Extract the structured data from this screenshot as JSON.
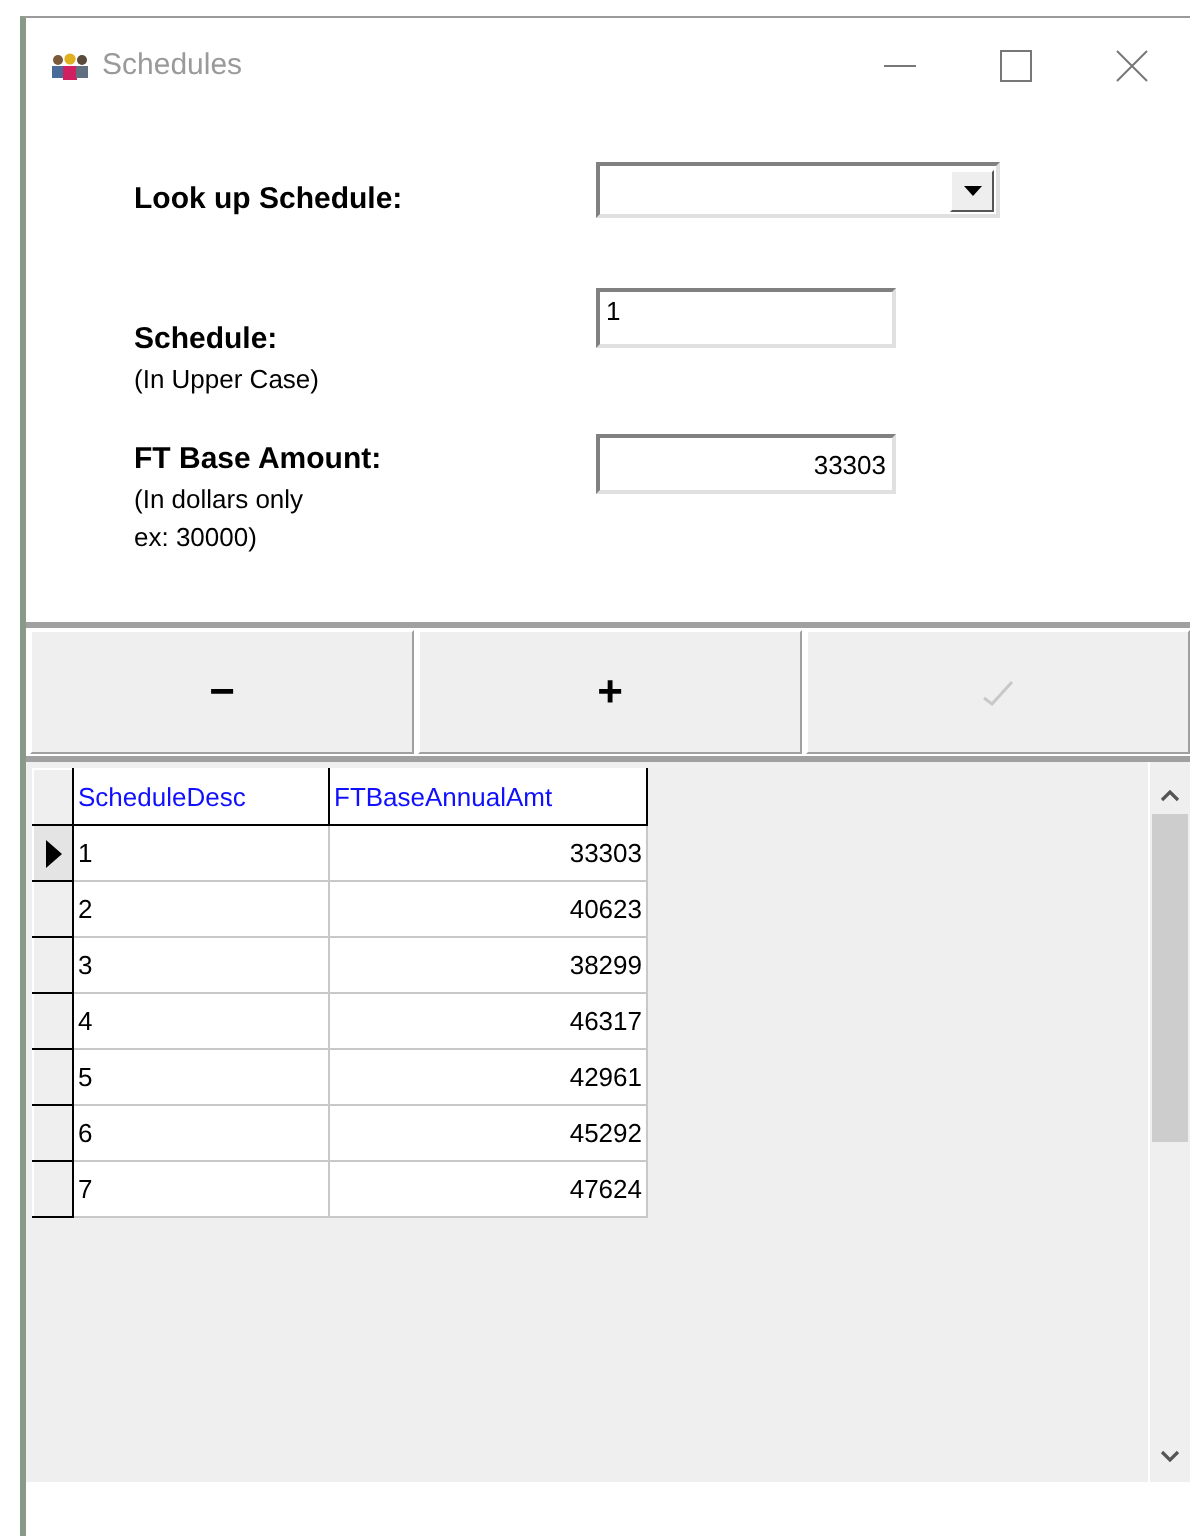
{
  "window": {
    "title": "Schedules"
  },
  "form": {
    "lookup": {
      "label": "Look up Schedule:"
    },
    "schedule": {
      "label": "Schedule:",
      "hint": "(In Upper Case)",
      "value": "1"
    },
    "amount": {
      "label": "FT Base Amount:",
      "hint_lines": [
        "(In dollars only",
        "ex: 30000)"
      ],
      "value": "33303"
    }
  },
  "buttons": [
    {
      "kind": "remove",
      "label": "−",
      "disabled": false
    },
    {
      "kind": "add",
      "label": "+",
      "disabled": false
    },
    {
      "kind": "confirm",
      "disabled": true
    }
  ],
  "table": {
    "columns": [
      "ScheduleDesc",
      "FTBaseAnnualAmt"
    ],
    "rows": [
      {
        "selected": true,
        "cells": [
          "1",
          "33303"
        ]
      },
      {
        "selected": false,
        "cells": [
          "2",
          "40623"
        ]
      },
      {
        "selected": false,
        "cells": [
          "3",
          "38299"
        ]
      },
      {
        "selected": false,
        "cells": [
          "4",
          "46317"
        ]
      },
      {
        "selected": false,
        "cells": [
          "5",
          "42961"
        ]
      },
      {
        "selected": false,
        "cells": [
          "6",
          "45292"
        ]
      },
      {
        "selected": false,
        "cells": [
          "7",
          "47624"
        ]
      }
    ]
  }
}
